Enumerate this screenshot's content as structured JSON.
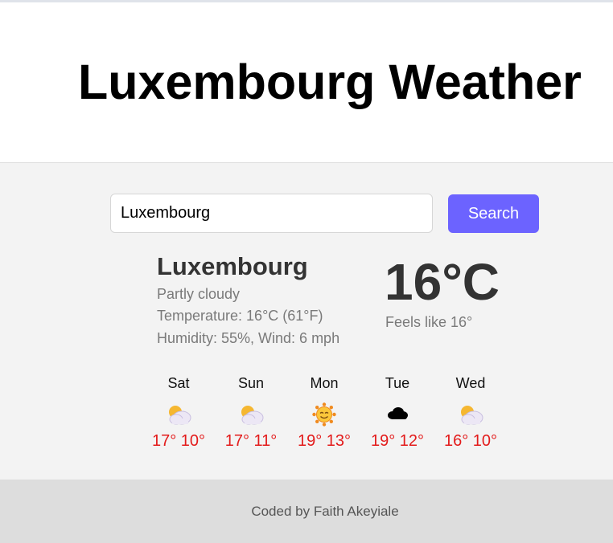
{
  "header": {
    "title": "Luxembourg Weather"
  },
  "search": {
    "value": "Luxembourg",
    "button_label": "Search"
  },
  "current": {
    "city": "Luxembourg",
    "description": "Partly cloudy",
    "temperature_line": "Temperature: 16°C (61°F)",
    "humidity_wind_line": "Humidity: 55%, Wind: 6 mph",
    "big_temperature": "16°C",
    "feels_like": "Feels like 16°"
  },
  "forecast": [
    {
      "day": "Sat",
      "icon": "partly-cloudy-icon",
      "high": "17°",
      "low": "10°"
    },
    {
      "day": "Sun",
      "icon": "partly-cloudy-icon",
      "high": "17°",
      "low": "11°"
    },
    {
      "day": "Mon",
      "icon": "sunny-icon",
      "high": "19°",
      "low": "13°"
    },
    {
      "day": "Tue",
      "icon": "cloud-icon",
      "high": "19°",
      "low": "12°"
    },
    {
      "day": "Wed",
      "icon": "partly-cloudy-icon",
      "high": "16°",
      "low": "10°"
    }
  ],
  "colors": {
    "accent": "#6c63ff",
    "forecast_temp": "#e31b1b",
    "footer_bg": "#dddddd",
    "main_bg": "#f3f3f3"
  },
  "footer": {
    "credit": "Coded by Faith Akeyiale"
  }
}
